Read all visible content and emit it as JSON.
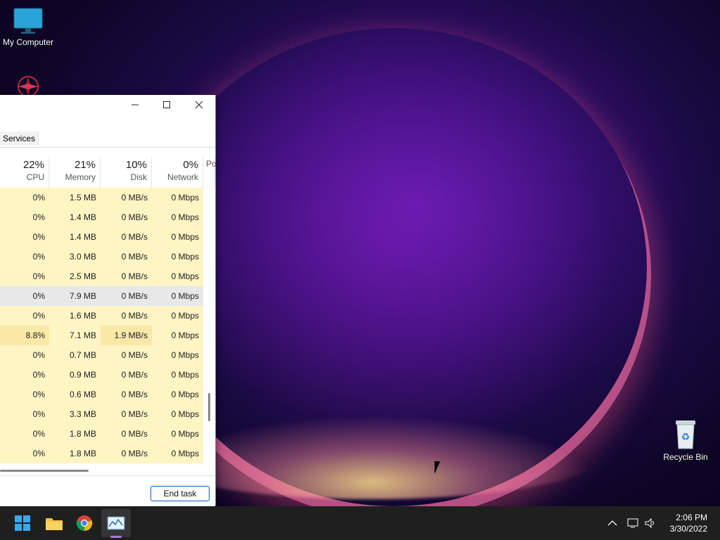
{
  "desktop": {
    "icons": [
      {
        "label": "My Computer"
      },
      {
        "label": ""
      },
      {
        "label": "Recycle Bin"
      }
    ]
  },
  "task_manager": {
    "tab_services": "Services",
    "columns": [
      {
        "pct": "22%",
        "label": "CPU"
      },
      {
        "pct": "21%",
        "label": "Memory"
      },
      {
        "pct": "10%",
        "label": "Disk"
      },
      {
        "pct": "0%",
        "label": "Network"
      },
      {
        "pct": "",
        "label": "Po"
      }
    ],
    "rows": [
      [
        "0%",
        "1.5 MB",
        "0 MB/s",
        "0 Mbps"
      ],
      [
        "0%",
        "1.4 MB",
        "0 MB/s",
        "0 Mbps"
      ],
      [
        "0%",
        "1.4 MB",
        "0 MB/s",
        "0 Mbps"
      ],
      [
        "0%",
        "3.0 MB",
        "0 MB/s",
        "0 Mbps"
      ],
      [
        "0%",
        "2.5 MB",
        "0 MB/s",
        "0 Mbps"
      ],
      [
        "0%",
        "7.9 MB",
        "0 MB/s",
        "0 Mbps"
      ],
      [
        "0%",
        "1.6 MB",
        "0 MB/s",
        "0 Mbps"
      ],
      [
        "8.8%",
        "7.1 MB",
        "1.9 MB/s",
        "0 Mbps"
      ],
      [
        "0%",
        "0.7 MB",
        "0 MB/s",
        "0 Mbps"
      ],
      [
        "0%",
        "0.9 MB",
        "0 MB/s",
        "0 Mbps"
      ],
      [
        "0%",
        "0.6 MB",
        "0 MB/s",
        "0 Mbps"
      ],
      [
        "0%",
        "3.3 MB",
        "0 MB/s",
        "0 Mbps"
      ],
      [
        "0%",
        "1.8 MB",
        "0 MB/s",
        "0 Mbps"
      ],
      [
        "0%",
        "1.8 MB",
        "0 MB/s",
        "0 Mbps"
      ]
    ],
    "selected_row": 5,
    "end_task": "End task"
  },
  "taskbar": {
    "time": "2:06 PM",
    "date": "3/30/2022",
    "pinned": [
      "windows-start-icon",
      "file-explorer-icon",
      "chrome-icon",
      "task-manager-icon"
    ]
  }
}
